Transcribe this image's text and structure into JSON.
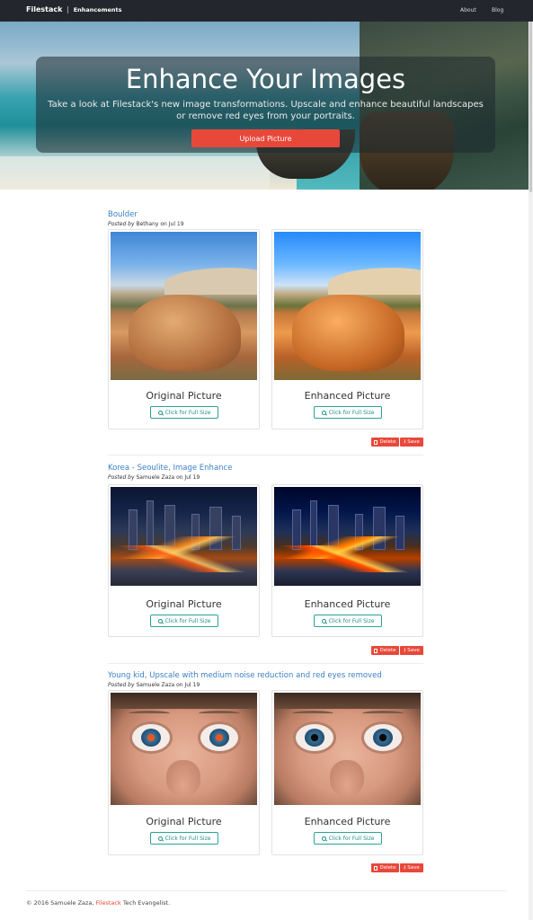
{
  "navbar": {
    "brand": "Filestack",
    "separator": "|",
    "subtitle": "Enhancements",
    "links": [
      "About",
      "Blog"
    ]
  },
  "hero": {
    "title": "Enhance Your Images",
    "text": "Take a look at Filestack's new image transformations. Upscale and enhance beautiful landscapes or remove red eyes from your portraits.",
    "upload_label": "Upload Picture"
  },
  "posts": [
    {
      "title": "Boulder",
      "posted_by_label": "Posted by",
      "author": "Bethany",
      "date_text": "on Jul 19",
      "original_label": "Original Picture",
      "enhanced_label": "Enhanced Picture",
      "fullsize_label": "Click for Full Size",
      "delete_label": "Delete",
      "save_label": "Save"
    },
    {
      "title": "Korea - Seoulite, Image Enhance",
      "posted_by_label": "Posted by",
      "author": "Samuele Zaza",
      "date_text": "on Jul 19",
      "original_label": "Original Picture",
      "enhanced_label": "Enhanced Picture",
      "fullsize_label": "Click for Full Size",
      "delete_label": "Delete",
      "save_label": "Save"
    },
    {
      "title": "Young kid, Upscale with medium noise reduction and red eyes removed",
      "posted_by_label": "Posted by",
      "author": "Samuele Zaza",
      "date_text": "on Jul 19",
      "original_label": "Original Picture",
      "enhanced_label": "Enhanced Picture",
      "fullsize_label": "Click for Full Size",
      "delete_label": "Delete",
      "save_label": "Save"
    }
  ],
  "footer": {
    "prefix": "© 2016 Samuele Zaza,",
    "brand": "Filestack",
    "suffix": "Tech Evangelist."
  },
  "colors": {
    "accent": "#e8483a",
    "link": "#3b80c6",
    "teal": "#2aa39b",
    "navbar": "#23272d"
  }
}
